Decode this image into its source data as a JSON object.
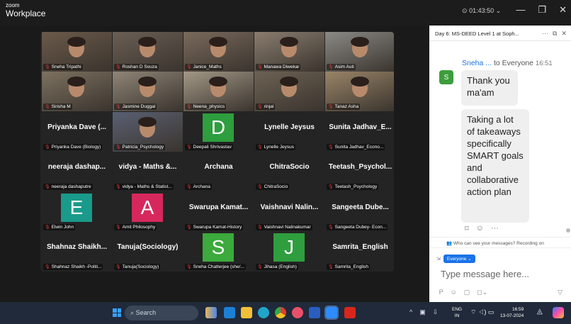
{
  "window": {
    "brand_small": "zoom",
    "brand_big": "Workplace",
    "timer": "01:43:50",
    "minimize": "—",
    "maximize": "❐",
    "close": "✕"
  },
  "tiles": [
    {
      "label": "Sneha Tripathi",
      "kind": "video",
      "color": "#6b5a4a"
    },
    {
      "label": "Roshan D Souza",
      "kind": "video",
      "color": "#6a5f55",
      "active": true
    },
    {
      "label": "Janice_Maths",
      "kind": "video",
      "color": "#7a6a5c"
    },
    {
      "label": "Manawa Diwekar",
      "kind": "video",
      "color": "#8a7d6f"
    },
    {
      "label": "Asim Auti",
      "kind": "video",
      "color": "#8b8a86"
    },
    {
      "label": "Sirisha M",
      "kind": "video",
      "color": "#7d7260"
    },
    {
      "label": "Jasmine Duggal",
      "kind": "video",
      "color": "#8f8577"
    },
    {
      "label": "Neena_physics",
      "kind": "video",
      "color": "#a39886"
    },
    {
      "label": "rinjal",
      "kind": "video",
      "color": "#6d6254"
    },
    {
      "label": "Tanaz Asha",
      "kind": "video",
      "color": "#9a8468"
    },
    {
      "label": "Priyanka Dave (Biology)",
      "kind": "name",
      "bigname": "Priyanka Dave (..."
    },
    {
      "label": "Patricia_Psychology",
      "kind": "photo",
      "color": "#5a6072"
    },
    {
      "label": "Deepali Shrivastav",
      "kind": "avatar",
      "letter": "D",
      "color": "#2e9e3e"
    },
    {
      "label": "Lynelle Jeysus",
      "kind": "name",
      "bigname": "Lynelle Jeysus"
    },
    {
      "label": "Sunita Jadhav_Econo...",
      "kind": "name",
      "bigname": "Sunita Jadhav_E..."
    },
    {
      "label": "neeraja dashaputre",
      "kind": "name",
      "bigname": "neeraja dashap..."
    },
    {
      "label": "vidya - Maths & Statist...",
      "kind": "name",
      "bigname": "vidya - Maths &..."
    },
    {
      "label": "Archana",
      "kind": "name",
      "bigname": "Archana"
    },
    {
      "label": "ChitraSocio",
      "kind": "name",
      "bigname": "ChitraSocio"
    },
    {
      "label": "Teetash_Psychology",
      "kind": "name",
      "bigname": "Teetash_Psychol..."
    },
    {
      "label": "Elwin John",
      "kind": "avatar",
      "letter": "E",
      "color": "#1a9a8a"
    },
    {
      "label": "Amit Philosophy",
      "kind": "avatar",
      "letter": "A",
      "color": "#d6285c"
    },
    {
      "label": "Swarupa Kamat-History",
      "kind": "name",
      "bigname": "Swarupa Kamat..."
    },
    {
      "label": "Vaishnavi Nalinakumar",
      "kind": "name",
      "bigname": "Vaishnavi Nalin..."
    },
    {
      "label": "Sangeeta Dubey- Econ...",
      "kind": "name",
      "bigname": "Sangeeta Dube..."
    },
    {
      "label": "Shahnaz Shaikh -Politi...",
      "kind": "name",
      "bigname": "Shahnaz Shaikh..."
    },
    {
      "label": "Tanuja(Sociology)",
      "kind": "name",
      "bigname": "Tanuja(Sociology)"
    },
    {
      "label": "Sneha Chatterjee (she/...",
      "kind": "avatar",
      "letter": "S",
      "color": "#3caa3c"
    },
    {
      "label": "Jihasa (English)",
      "kind": "avatar",
      "letter": "J",
      "color": "#2e9e3e"
    },
    {
      "label": "Samrita_English",
      "kind": "name",
      "bigname": "Samrita_English"
    }
  ],
  "chat": {
    "title": "Day 6: MS-DEED Level 1 at Soph...",
    "header_icons": [
      "···",
      "⧉",
      "✕"
    ],
    "sender": "Sneha ...",
    "to": "to Everyone",
    "time": "16:51",
    "avatar_letter": "S",
    "message1": "Thank you ma'am",
    "message2": "Taking a lot of takeaways specifically SMART goals and collaborative action plan",
    "privacy": "Who can see your messages? Recording on",
    "to_pill": "Everyone ⌄",
    "placeholder": "Type message here..."
  },
  "taskbar": {
    "search": "Search",
    "lang_top": "ENG",
    "lang_bottom": "IN",
    "time": "16:59",
    "date": "13-07-2024"
  }
}
